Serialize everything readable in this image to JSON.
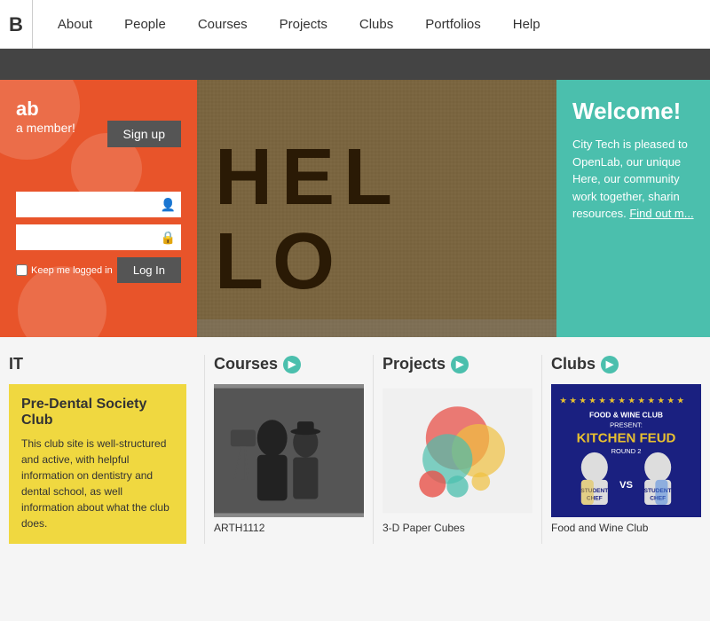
{
  "navbar": {
    "logo": "B",
    "links": [
      {
        "label": "About",
        "href": "#"
      },
      {
        "label": "People",
        "href": "#"
      },
      {
        "label": "Courses",
        "href": "#"
      },
      {
        "label": "Projects",
        "href": "#"
      },
      {
        "label": "Clubs",
        "href": "#"
      },
      {
        "label": "Portfolios",
        "href": "#"
      },
      {
        "label": "Help",
        "href": "#"
      }
    ]
  },
  "login": {
    "site_name": "ab",
    "subtitle": "a member!",
    "signup_label": "Sign up",
    "username_placeholder": "",
    "password_placeholder": "",
    "remember_label": "Keep me logged in",
    "login_label": "Log In"
  },
  "welcome": {
    "title": "Welcome!",
    "text": "City Tech is pleased to OpenLab, our unique Here, our community work together, sharin resources.",
    "link_text": "Find out m..."
  },
  "main": {
    "featured_title": "IT",
    "featured_card": {
      "title": "Pre-Dental Society Club",
      "description": "This club site is well-structured and active, with helpful information on dentistry and dental school, as well information about what the club does."
    },
    "courses": {
      "title": "Courses",
      "item_title": "ARTH1112"
    },
    "projects": {
      "title": "Projects",
      "item_title": "3-D Paper Cubes"
    },
    "clubs": {
      "title": "Clubs",
      "item_title": "Food and Wine Club"
    }
  }
}
